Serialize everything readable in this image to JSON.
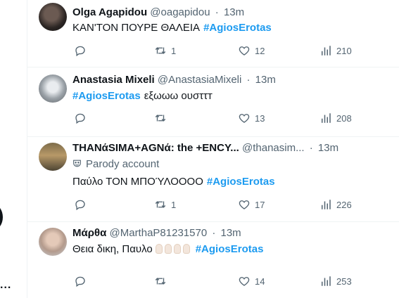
{
  "left_rail": {
    "dots": "..."
  },
  "tweets": [
    {
      "name": "Olga Agapidou",
      "handle": "@oagapidou",
      "sep": "·",
      "time": "13m",
      "text": "ΚΑΝ'ΤΟΝ ΠΟΥΡΕ ΘΑΛΕΙΑ",
      "hashtag": "#AgiosErotas",
      "retweets": "1",
      "likes": "12",
      "views": "210"
    },
    {
      "name": "Anastasia Mixeli",
      "handle": "@AnastasiaMixeli",
      "sep": "·",
      "time": "13m",
      "hashtag": "#AgiosErotas",
      "text": "εξωωω ουσττт",
      "retweets": "",
      "likes": "13",
      "views": "208"
    },
    {
      "name": "THANάSIMA+AGNά: the +ENCY...",
      "handle": "@thanasim...",
      "sep": "·",
      "time": "13m",
      "badge": "Parody account",
      "text": "Παύλο ΤΟΝ ΜΠΟΎΛΟΟΟΟ",
      "hashtag": "#AgiosErotas",
      "retweets": "1",
      "likes": "17",
      "views": "226"
    },
    {
      "name": "Μάρθα",
      "handle": "@MarthaP81231570",
      "sep": "·",
      "time": "13m",
      "text": "Θεια δικη, Παυλο",
      "hashtag": "#AgiosErotas",
      "retweets": "",
      "likes": "14",
      "views": "253"
    }
  ],
  "icons": {
    "reply": "reply-icon",
    "retweet": "retweet-icon",
    "like": "heart-icon",
    "views": "views-chart-icon",
    "parody": "mask-icon"
  },
  "colors": {
    "hashtag": "#1d9bf0",
    "secondary": "#536471",
    "text": "#0f1419",
    "divider": "#eff3f4"
  }
}
